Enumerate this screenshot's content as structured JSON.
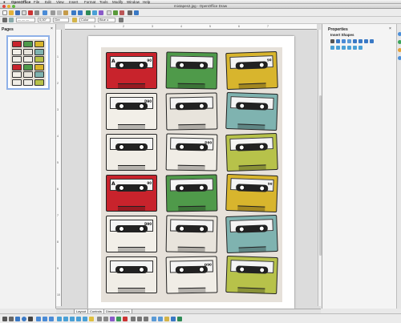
{
  "menubar": {
    "app_name": "OpenOffice",
    "items": [
      "File",
      "Edit",
      "View",
      "Insert",
      "Format",
      "Tools",
      "Modify",
      "Window",
      "Help"
    ]
  },
  "window": {
    "title": "mixtapes2.jpg - OpenOffice Draw"
  },
  "toolbar": {
    "line_width": "0,00\"",
    "line_color": "Gre",
    "area_style": "Color",
    "area_color": "Blue o"
  },
  "pages_panel": {
    "title": "Pages",
    "close": "×"
  },
  "properties_panel": {
    "title": "Properties",
    "section": "Insert Shapes",
    "close": "×"
  },
  "ruler": {
    "h_ticks": [
      "1",
      "2",
      "3",
      "4",
      "5",
      "6",
      "7"
    ],
    "v_ticks": [
      "1",
      "2",
      "3",
      "4",
      "5",
      "6",
      "7",
      "8",
      "9",
      "10"
    ]
  },
  "tabs": [
    "Layout",
    "Controls",
    "Dimension Lines"
  ],
  "cassettes": [
    {
      "color": "#c8232c",
      "side": "A",
      "note": "90"
    },
    {
      "color": "#4f9a4a",
      "side": "",
      "note": ""
    },
    {
      "color": "#d8b52d",
      "side": "",
      "note": "90"
    },
    {
      "color": "#f2efe8",
      "side": "",
      "note": "D90"
    },
    {
      "color": "#e8e4dc",
      "side": "",
      "note": ""
    },
    {
      "color": "#7fb3b0",
      "side": "",
      "note": ""
    },
    {
      "color": "#f0ede6",
      "side": "",
      "note": ""
    },
    {
      "color": "#f0ede6",
      "side": "",
      "note": "D90"
    },
    {
      "color": "#b7c24a",
      "side": "",
      "note": ""
    },
    {
      "color": "#c8232c",
      "side": "A",
      "note": "90"
    },
    {
      "color": "#4f9a4a",
      "side": "",
      "note": ""
    },
    {
      "color": "#d8b52d",
      "side": "",
      "note": "90"
    },
    {
      "color": "#f2efe8",
      "side": "",
      "note": "D90"
    },
    {
      "color": "#e8e4dc",
      "side": "",
      "note": ""
    },
    {
      "color": "#7fb3b0",
      "side": "",
      "note": ""
    },
    {
      "color": "#f0ede6",
      "side": "",
      "note": ""
    },
    {
      "color": "#f0ede6",
      "side": "",
      "note": "D90"
    },
    {
      "color": "#b7c24a",
      "side": "",
      "note": ""
    }
  ]
}
